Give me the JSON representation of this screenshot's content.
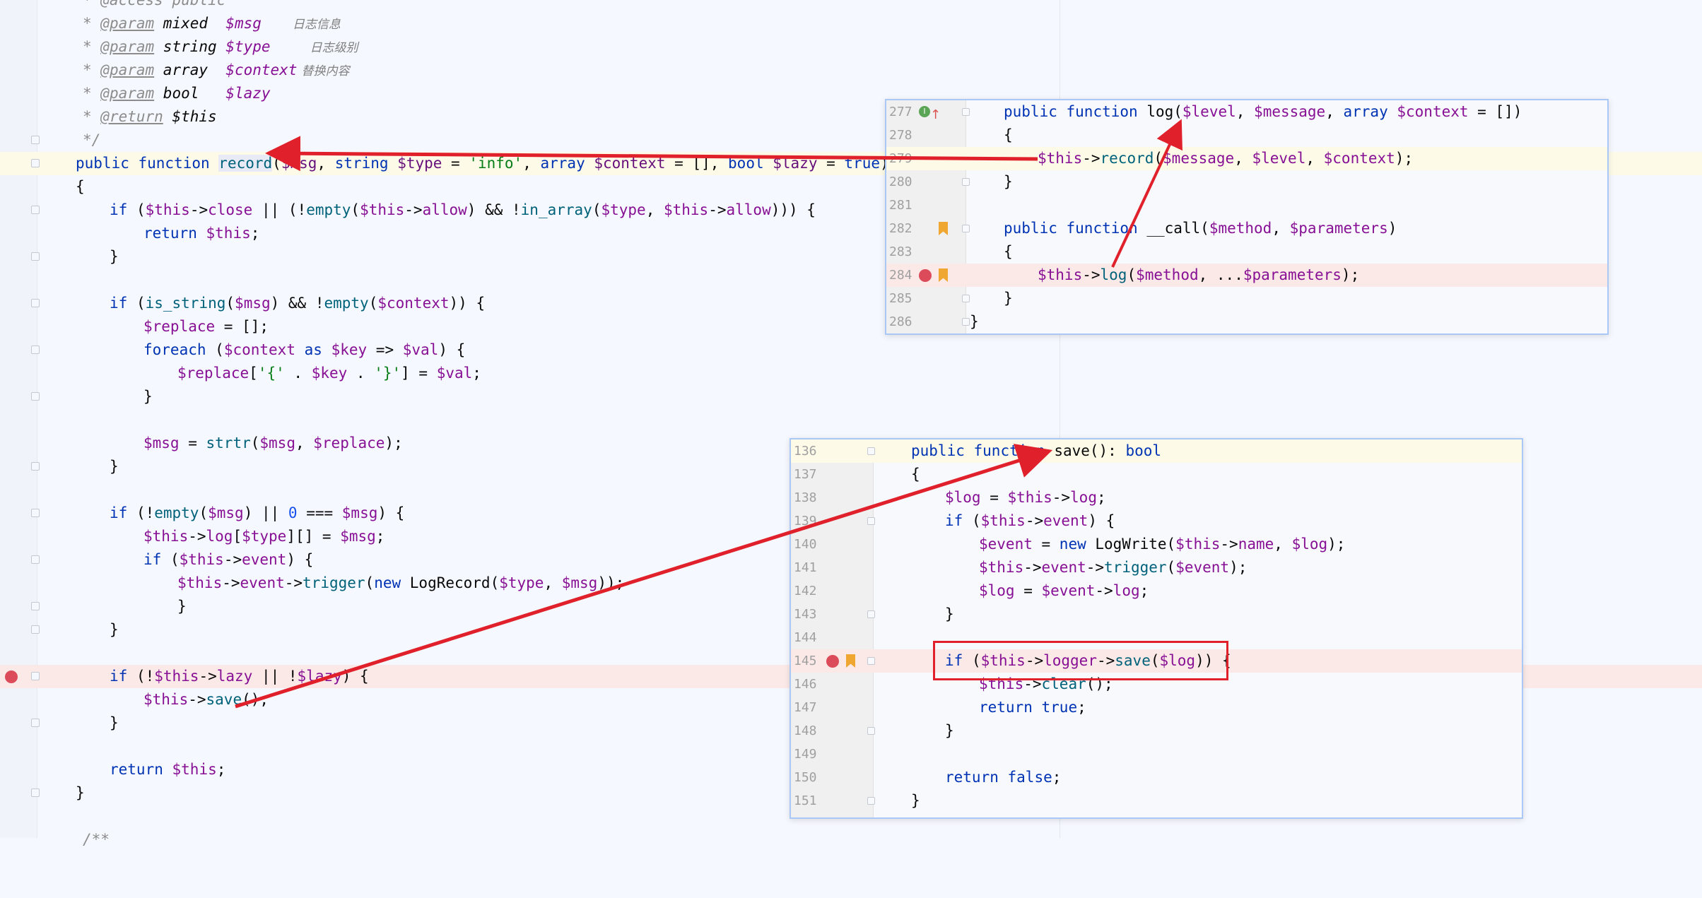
{
  "main_editor": {
    "doc": {
      "access": "* @access public",
      "p1_tag": "@param",
      "p1_type": " mixed  ",
      "p1_var": "$msg",
      "p1_cn": "日志信息",
      "p2_tag": "@param",
      "p2_type": " string ",
      "p2_var": "$type",
      "p2_cn": "日志级别",
      "p3_tag": "@param",
      "p3_type": " array  ",
      "p3_var": "$context",
      "p3_cn": "替换内容",
      "p4_tag": "@param",
      "p4_type": " bool   ",
      "p4_var": "$lazy",
      "ret_tag": "@return",
      "ret_var": "$this",
      "close": "*/"
    },
    "sig": {
      "kw1": "public function ",
      "name": "record",
      "p1": "$msg",
      "sep1": ", ",
      "t2": "string",
      "p2": " $type",
      "eq": " = ",
      "def2": "'info'",
      "sep2": ", ",
      "t3": "array",
      "p3": " $context",
      "def3": " = [], ",
      "t4": "bool",
      "p4": " $lazy",
      "eq4": " = ",
      "def4": "true",
      "end": ")"
    },
    "brace_open": "{",
    "l1": "if ($this->close || (!empty($this->allow) && !in_array($type, $this->allow))) {",
    "l2": "return $this;",
    "close_brace": "}",
    "l4": "if (is_string($msg) && !empty($context)) {",
    "l5": "$replace = [];",
    "l6": "foreach ($context as $key => $val) {",
    "l7": "$replace['{' . $key . '}'] = $val;",
    "l9": "$msg = strtr($msg, $replace);",
    "l11": "if (!empty($msg) || 0 === $msg) {",
    "l12": "$this->log[$type][] = $msg;",
    "l13": "if ($this->event) {",
    "l14": "$this->event->trigger(new LogRecord($type, $msg));",
    "l17": "if (!$this->lazy || !$lazy) {",
    "l18": "$this->save();",
    "l20": "return $this;",
    "last": "/**"
  },
  "popup_top": {
    "lines": [
      {
        "n": "277",
        "text": "public function log($level, $message, array $context = [])"
      },
      {
        "n": "278",
        "text": "{"
      },
      {
        "n": "279",
        "text": "$this->record($message, $level, $context);"
      },
      {
        "n": "280",
        "text": "}"
      },
      {
        "n": "281",
        "text": ""
      },
      {
        "n": "282",
        "text": "public function __call($method, $parameters)"
      },
      {
        "n": "283",
        "text": "{"
      },
      {
        "n": "284",
        "text": "$this->log($method, ...$parameters);"
      },
      {
        "n": "285",
        "text": "}"
      },
      {
        "n": "286",
        "text": "}"
      }
    ]
  },
  "popup_bottom": {
    "lines": [
      {
        "n": "136",
        "text": "public function save(): bool"
      },
      {
        "n": "137",
        "text": "{"
      },
      {
        "n": "138",
        "text": "$log = $this->log;"
      },
      {
        "n": "139",
        "text": "if ($this->event) {"
      },
      {
        "n": "140",
        "text": "$event = new LogWrite($this->name, $log);"
      },
      {
        "n": "141",
        "text": "$this->event->trigger($event);"
      },
      {
        "n": "142",
        "text": "$log = $event->log;"
      },
      {
        "n": "143",
        "text": "}"
      },
      {
        "n": "144",
        "text": ""
      },
      {
        "n": "145",
        "text": "if ($this->logger->save($log)) {"
      },
      {
        "n": "146",
        "text": "$this->clear();"
      },
      {
        "n": "147",
        "text": "return true;"
      },
      {
        "n": "148",
        "text": "}"
      },
      {
        "n": "149",
        "text": ""
      },
      {
        "n": "150",
        "text": "return false;"
      },
      {
        "n": "151",
        "text": "}"
      }
    ]
  },
  "colors": {
    "arrow": "#e0202a",
    "breakpoint": "#db4b5a",
    "bookmark": "#f0a732",
    "keyword": "#0033b3",
    "string": "#067d17"
  },
  "icons": [
    "breakpoint-icon",
    "bookmark-icon",
    "implements-icon",
    "fold-marker-icon"
  ]
}
